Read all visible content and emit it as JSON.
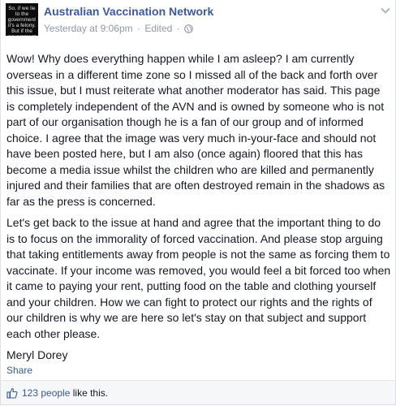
{
  "post": {
    "avatar_text": "So, if we lie to the government it's a felony. But if the government lies to us, it's politics.",
    "page_name": "Australian Vaccination Network",
    "timestamp": "Yesterday at 9:06pm",
    "separator": "·",
    "edited": "Edited",
    "paragraphs": [
      "Wow! Why does everything happen while I am asleep? I am currently overseas in a different time zone so I missed all of the back and forth over this issue, but I must reiterate what another moderator has said. This page is completely independent of the AVN and is owned by someone who is not part of our organisation though he is a fan of our group and of informed choice. I agree that the image was very much in-your-face and should not have been posted here, but I am also (once again) floored that this has become a media issue whilst the children who are killed and permanently injured and their families that are often destroyed remain in the shadows as far as the press is concerned.",
      "Let's get back to the issue at hand and agree that the important thing to do is to focus on the immorality of forced vaccination. And please stop arguing that taking entitlements away from people is not the same as forcing them to vaccinate. If your income was removed, you would feel a bit forced too when it came to paying your rent, putting food on the table and clothing yourself and your children. How we can fight to protect our rights and the rights of our children is why we are here so let's stay on that subject and support each other please.",
      "Meryl Dorey"
    ],
    "share_label": "Share",
    "likes_count": "123 people",
    "likes_suffix": "like this."
  },
  "icons": {
    "options": "chevron-down-icon",
    "privacy": "globe-icon",
    "like": "thumbs-up-icon"
  },
  "colors": {
    "link": "#3b5998",
    "meta": "#9197a3",
    "text": "#141823",
    "footer_bg": "#f6f7f9"
  }
}
